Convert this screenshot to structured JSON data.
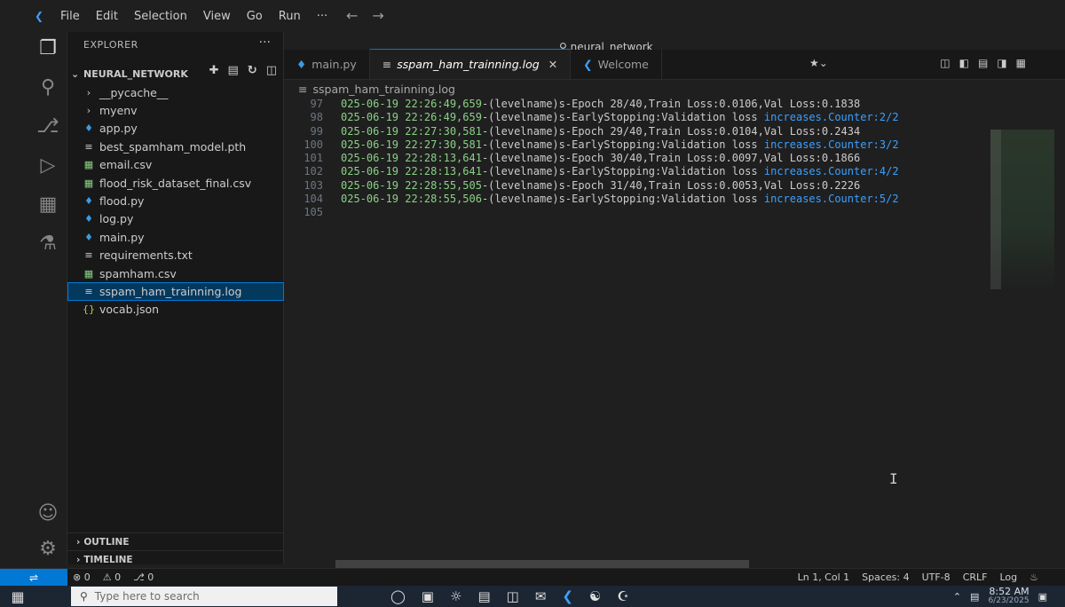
{
  "menu": [
    "File",
    "Edit",
    "Selection",
    "View",
    "Go",
    "Run",
    "···"
  ],
  "command_center": "neural_network",
  "sidebar": {
    "title": "EXPLORER",
    "folder": "NEURAL_NETWORK",
    "items": [
      {
        "label": "__pycache__",
        "type": "folder"
      },
      {
        "label": "myenv",
        "type": "folder"
      },
      {
        "label": "app.py",
        "type": "py"
      },
      {
        "label": "best_spamham_model.pth",
        "type": "pth"
      },
      {
        "label": "email.csv",
        "type": "csv"
      },
      {
        "label": "flood_risk_dataset_final.csv",
        "type": "csv"
      },
      {
        "label": "flood.py",
        "type": "py"
      },
      {
        "label": "log.py",
        "type": "py"
      },
      {
        "label": "main.py",
        "type": "py"
      },
      {
        "label": "requirements.txt",
        "type": "txt"
      },
      {
        "label": "spamham.csv",
        "type": "csv"
      },
      {
        "label": "sspam_ham_trainning.log",
        "type": "log",
        "selected": true
      },
      {
        "label": "vocab.json",
        "type": "json"
      }
    ],
    "outline": "OUTLINE",
    "timeline": "TIMELINE"
  },
  "tabs": [
    {
      "label": "main.py",
      "icon": "python-icon"
    },
    {
      "label": "sspam_ham_trainning.log",
      "icon": "log-file-icon",
      "active": true
    },
    {
      "label": "Welcome",
      "icon": "vscode-icon"
    }
  ],
  "breadcrumb": "sspam_ham_trainning.log",
  "editor": {
    "lines": [
      {
        "num": "97",
        "ts": "025-06-19 22:26:49,659",
        "text": "-(levelname)s-Epoch 28/40,Train Loss:0.0106,Val Loss:0.1838",
        "kw": ""
      },
      {
        "num": "98",
        "ts": "025-06-19 22:26:49,659",
        "text": "-(levelname)s-EarlyStopping:Validation loss ",
        "kw": "increases.Counter:2/2"
      },
      {
        "num": "99",
        "ts": "025-06-19 22:27:30,581",
        "text": "-(levelname)s-Epoch 29/40,Train Loss:0.0104,Val Loss:0.2434",
        "kw": ""
      },
      {
        "num": "100",
        "ts": "025-06-19 22:27:30,581",
        "text": "-(levelname)s-EarlyStopping:Validation loss ",
        "kw": "increases.Counter:3/2"
      },
      {
        "num": "101",
        "ts": "025-06-19 22:28:13,641",
        "text": "-(levelname)s-Epoch 30/40,Train Loss:0.0097,Val Loss:0.1866",
        "kw": ""
      },
      {
        "num": "102",
        "ts": "025-06-19 22:28:13,641",
        "text": "-(levelname)s-EarlyStopping:Validation loss ",
        "kw": "increases.Counter:4/2"
      },
      {
        "num": "103",
        "ts": "025-06-19 22:28:55,505",
        "text": "-(levelname)s-Epoch 31/40,Train Loss:0.0053,Val Loss:0.2226",
        "kw": ""
      },
      {
        "num": "104",
        "ts": "025-06-19 22:28:55,506",
        "text": "-(levelname)s-EarlyStopping:Validation loss ",
        "kw": "increases.Counter:5/2"
      },
      {
        "num": "105",
        "ts": "",
        "text": "",
        "kw": ""
      }
    ]
  },
  "status": {
    "errors": "⊗ 0",
    "warnings": "⚠ 0",
    "ports": "⎇ 0",
    "position": "Ln 1, Col 1",
    "spaces": "Spaces: 4",
    "encoding": "UTF-8",
    "eol": "CRLF",
    "language": "Log"
  },
  "taskbar": {
    "search_placeholder": "Type here to search",
    "time": "8:52 AM",
    "date": "6/23/2025"
  },
  "colors": {
    "accent": "#0078d4",
    "timestamp": "#89d185",
    "keyword": "#3ca0ff"
  }
}
